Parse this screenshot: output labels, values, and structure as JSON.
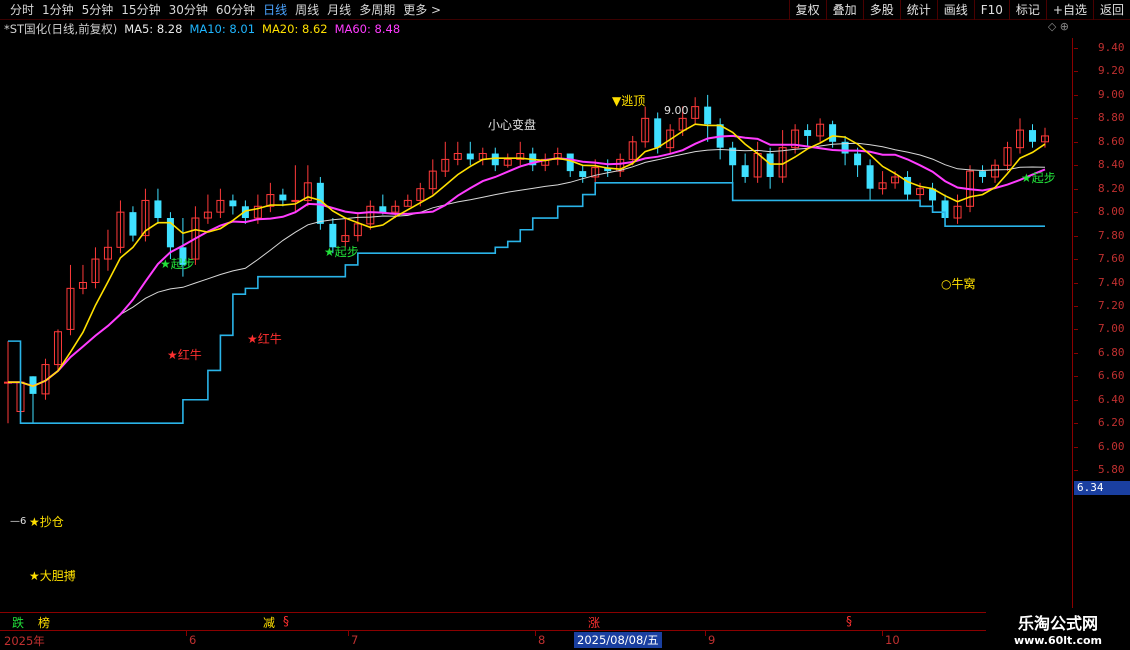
{
  "toolbar": {
    "periods": [
      "分时",
      "1分钟",
      "5分钟",
      "15分钟",
      "30分钟",
      "60分钟",
      "日线",
      "周线",
      "月线",
      "多周期",
      "更多 >"
    ],
    "active": "日线",
    "right_buttons": [
      "复权",
      "叠加",
      "多股",
      "统计",
      "画线",
      "F10",
      "标记",
      "+自选",
      "返回"
    ]
  },
  "info": {
    "title": "*ST国化(日线,前复权)",
    "ma5": "MA5: 8.28",
    "ma10": "MA10: 8.01",
    "ma20": "MA20: 8.62",
    "ma60": "MA60: 8.48",
    "icons": "◇ ⊕"
  },
  "price_axis": [
    "9.40",
    "9.20",
    "9.00",
    "8.80",
    "8.60",
    "8.40",
    "8.20",
    "8.00",
    "7.80",
    "7.60",
    "7.40",
    "7.20",
    "7.00",
    "6.80",
    "6.60",
    "6.40",
    "6.20",
    "6.00",
    "5.80"
  ],
  "current_price_tag": "6.34",
  "annotations": {
    "escape_top": "▼逃顶",
    "high_value": "9.00",
    "caution": "小心变盘",
    "red_bull_1": "★红牛",
    "red_bull_2": "★红牛",
    "start_1": "★起步",
    "start_2": "★起步",
    "start_3": "★起步",
    "bottom_build": "★抄仓",
    "bold_fight": "★大胆搏",
    "bull_nest": "○牛窝",
    "low_marker": "—6"
  },
  "bottom_strip": {
    "fall": "跌",
    "mark1": "榜",
    "reduce": "减",
    "s1": "§",
    "rise": "涨",
    "s2": "§"
  },
  "date_axis": {
    "labels": [
      "2025年",
      "6",
      "7",
      "8",
      "9",
      "10"
    ],
    "cursor": "2025/08/08/五"
  },
  "watermark": {
    "title": "乐淘公式网",
    "url": "www.60lt.com"
  },
  "chart_data": {
    "type": "candlestick",
    "ylim": [
      5.7,
      9.5
    ],
    "series_names": [
      "MA5",
      "MA10",
      "MA20",
      "MA60"
    ],
    "ma_colors": {
      "ma5": "#ffe000",
      "ma10": "#ff3cff",
      "ma20": "#d8d8d8",
      "support": "#2ab4e8"
    },
    "candles": [
      [
        6.55,
        6.55,
        6.25,
        6.2,
        6.9
      ],
      [
        6.3,
        6.55,
        6.2,
        6.65,
        6.2
      ],
      [
        6.6,
        6.45,
        6.5,
        6.2,
        6.6
      ],
      [
        6.45,
        6.7,
        6.4,
        6.75,
        6.4
      ],
      [
        6.7,
        6.98,
        6.7,
        7.0,
        6.65
      ],
      [
        7.0,
        7.35,
        7.0,
        7.55,
        6.95
      ],
      [
        7.35,
        7.4,
        7.35,
        7.55,
        7.3
      ],
      [
        7.4,
        7.6,
        7.4,
        7.7,
        7.35
      ],
      [
        7.6,
        7.7,
        7.55,
        7.85,
        7.5
      ],
      [
        7.7,
        8.0,
        7.7,
        8.1,
        7.65
      ],
      [
        8.0,
        7.8,
        7.8,
        8.05,
        7.75
      ],
      [
        7.8,
        8.1,
        7.8,
        8.2,
        7.75
      ],
      [
        8.1,
        7.95,
        7.95,
        8.2,
        7.9
      ],
      [
        7.95,
        7.7,
        7.65,
        8.0,
        7.6
      ],
      [
        7.7,
        7.55,
        7.5,
        7.95,
        7.45
      ],
      [
        7.6,
        7.95,
        7.6,
        8.05,
        7.55
      ],
      [
        7.95,
        8.0,
        7.9,
        8.15,
        7.9
      ],
      [
        8.0,
        8.1,
        8.0,
        8.2,
        7.95
      ],
      [
        8.1,
        8.05,
        8.0,
        8.15,
        7.98
      ],
      [
        8.05,
        7.95,
        7.95,
        8.1,
        7.9
      ],
      [
        7.95,
        8.05,
        7.95,
        8.15,
        7.9
      ],
      [
        8.05,
        8.15,
        8.05,
        8.25,
        8.0
      ],
      [
        8.15,
        8.1,
        8.05,
        8.2,
        8.05
      ],
      [
        8.1,
        8.1,
        8.0,
        8.4,
        8.0
      ],
      [
        8.1,
        8.25,
        8.1,
        8.4,
        8.05
      ],
      [
        8.25,
        7.9,
        7.85,
        8.3,
        7.85
      ],
      [
        7.9,
        7.7,
        7.75,
        7.95,
        7.65
      ],
      [
        7.75,
        7.8,
        7.75,
        7.95,
        7.7
      ],
      [
        7.8,
        7.9,
        7.8,
        8.0,
        7.75
      ],
      [
        7.9,
        8.05,
        7.9,
        8.1,
        7.85
      ],
      [
        8.05,
        8.0,
        8.0,
        8.15,
        7.98
      ],
      [
        8.0,
        8.05,
        8.0,
        8.1,
        7.95
      ],
      [
        8.05,
        8.1,
        8.05,
        8.15,
        8.05
      ],
      [
        8.1,
        8.2,
        8.1,
        8.25,
        8.05
      ],
      [
        8.2,
        8.35,
        8.2,
        8.45,
        8.15
      ],
      [
        8.35,
        8.45,
        8.35,
        8.6,
        8.3
      ],
      [
        8.45,
        8.5,
        8.45,
        8.6,
        8.4
      ],
      [
        8.5,
        8.45,
        8.4,
        8.6,
        8.4
      ],
      [
        8.45,
        8.5,
        8.45,
        8.55,
        8.4
      ],
      [
        8.5,
        8.4,
        8.4,
        8.55,
        8.35
      ],
      [
        8.4,
        8.45,
        8.4,
        8.5,
        8.38
      ],
      [
        8.45,
        8.5,
        8.45,
        8.6,
        8.4
      ],
      [
        8.5,
        8.4,
        8.35,
        8.55,
        8.35
      ],
      [
        8.4,
        8.45,
        8.4,
        8.5,
        8.35
      ],
      [
        8.45,
        8.5,
        8.45,
        8.55,
        8.4
      ],
      [
        8.5,
        8.35,
        8.35,
        8.5,
        8.3
      ],
      [
        8.35,
        8.3,
        8.3,
        8.4,
        8.25
      ],
      [
        8.3,
        8.38,
        8.3,
        8.45,
        8.25
      ],
      [
        8.38,
        8.35,
        8.32,
        8.45,
        8.3
      ],
      [
        8.35,
        8.45,
        8.35,
        8.5,
        8.3
      ],
      [
        8.45,
        8.6,
        8.45,
        8.65,
        8.4
      ],
      [
        8.6,
        8.8,
        8.6,
        8.9,
        8.55
      ],
      [
        8.8,
        8.55,
        8.55,
        8.85,
        8.5
      ],
      [
        8.55,
        8.7,
        8.55,
        8.75,
        8.5
      ],
      [
        8.7,
        8.8,
        8.7,
        8.9,
        8.65
      ],
      [
        8.8,
        8.9,
        8.78,
        8.98,
        8.75
      ],
      [
        8.9,
        8.75,
        8.7,
        9.0,
        8.6
      ],
      [
        8.75,
        8.55,
        8.5,
        8.8,
        8.45
      ],
      [
        8.55,
        8.4,
        8.35,
        8.6,
        8.1
      ],
      [
        8.4,
        8.3,
        8.3,
        8.5,
        8.25
      ],
      [
        8.3,
        8.5,
        8.3,
        8.6,
        8.25
      ],
      [
        8.5,
        8.3,
        8.25,
        8.55,
        8.2
      ],
      [
        8.3,
        8.55,
        8.3,
        8.7,
        8.25
      ],
      [
        8.55,
        8.7,
        8.55,
        8.75,
        8.5
      ],
      [
        8.7,
        8.65,
        8.6,
        8.75,
        8.55
      ],
      [
        8.65,
        8.75,
        8.65,
        8.8,
        8.6
      ],
      [
        8.75,
        8.6,
        8.55,
        8.78,
        8.55
      ],
      [
        8.6,
        8.5,
        8.45,
        8.65,
        8.4
      ],
      [
        8.5,
        8.4,
        8.35,
        8.55,
        8.3
      ],
      [
        8.4,
        8.2,
        8.15,
        8.45,
        8.1
      ],
      [
        8.2,
        8.25,
        8.2,
        8.35,
        8.15
      ],
      [
        8.25,
        8.3,
        8.2,
        8.35,
        8.2
      ],
      [
        8.3,
        8.15,
        8.1,
        8.35,
        8.1
      ],
      [
        8.15,
        8.2,
        8.1,
        8.25,
        8.05
      ],
      [
        8.2,
        8.1,
        8.05,
        8.25,
        8.0
      ],
      [
        8.1,
        7.95,
        7.9,
        8.15,
        7.88
      ],
      [
        7.95,
        8.05,
        7.95,
        8.15,
        7.9
      ],
      [
        8.05,
        8.35,
        8.05,
        8.4,
        8.0
      ],
      [
        8.35,
        8.3,
        8.25,
        8.4,
        8.25
      ],
      [
        8.3,
        8.4,
        8.3,
        8.45,
        8.25
      ],
      [
        8.4,
        8.55,
        8.4,
        8.6,
        8.35
      ],
      [
        8.55,
        8.7,
        8.55,
        8.8,
        8.5
      ],
      [
        8.7,
        8.6,
        8.55,
        8.75,
        8.55
      ],
      [
        8.6,
        8.65,
        8.6,
        8.72,
        8.55
      ]
    ]
  }
}
